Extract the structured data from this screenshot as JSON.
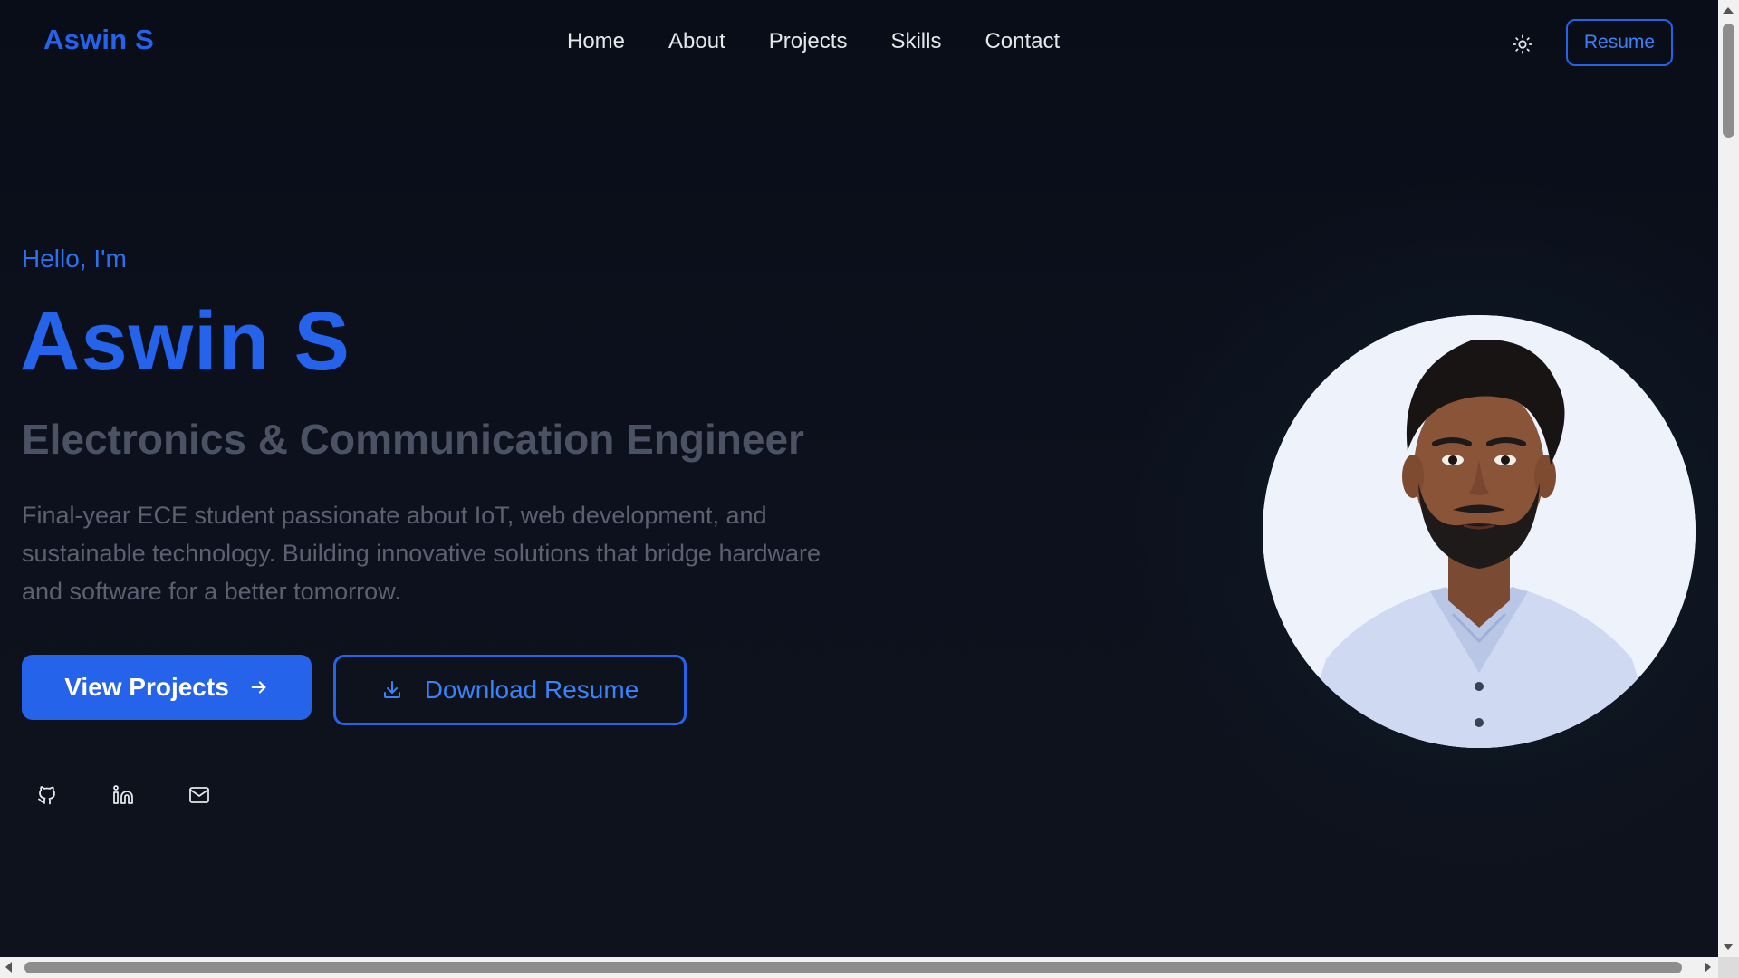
{
  "nav": {
    "brand": "Aswin S",
    "links": [
      "Home",
      "About",
      "Projects",
      "Skills",
      "Contact"
    ],
    "theme_toggle_icon": "sun-icon",
    "resume_label": "Resume"
  },
  "hero": {
    "greeting": "Hello, I'm",
    "name": "Aswin S",
    "role": "Electronics & Communication Engineer",
    "description": "Final-year ECE student passionate about IoT, web development, and sustainable technology. Building innovative solutions that bridge hardware and software for a better tomorrow.",
    "primary_button": "View Projects",
    "secondary_button": "Download Resume",
    "socials": [
      "github-icon",
      "linkedin-icon",
      "mail-icon"
    ]
  },
  "colors": {
    "accent": "#2563eb",
    "background": "#0b0f1a",
    "muted_text": "#5b6170"
  }
}
